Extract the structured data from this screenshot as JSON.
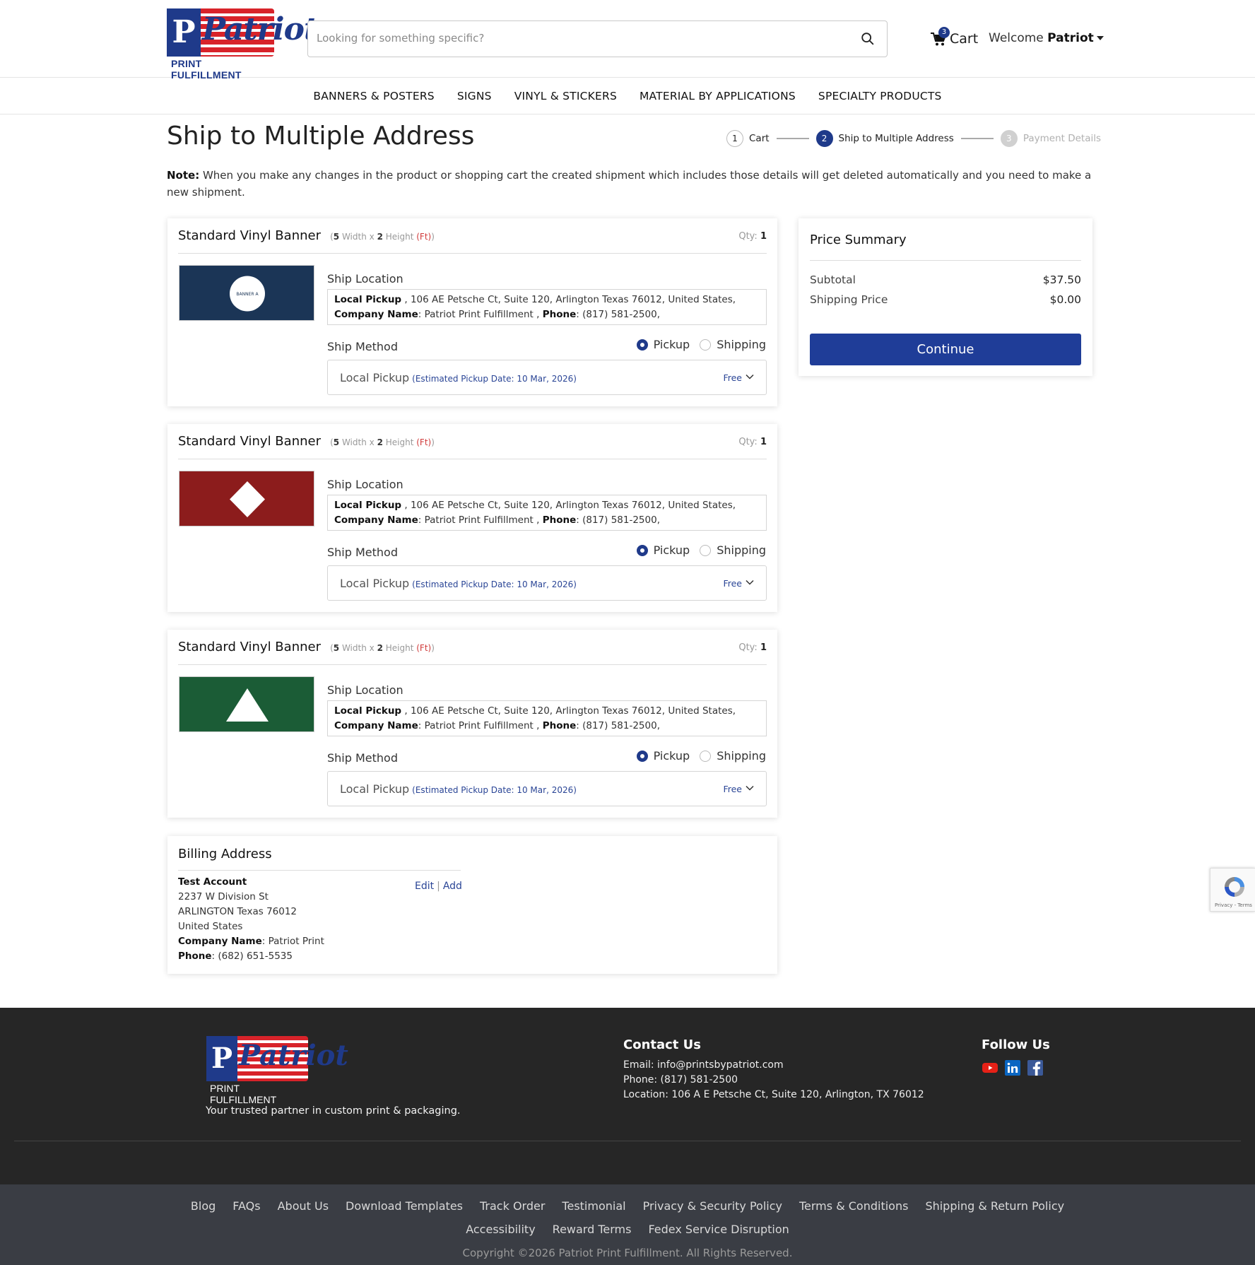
{
  "header": {
    "logo_word": "Patriot",
    "logo_sub": "PRINT FULFILLMENT",
    "search_placeholder": "Looking for something specific?",
    "cart_count": "3",
    "cart_label": "Cart",
    "welcome_prefix": "Welcome ",
    "welcome_user": "Patriot"
  },
  "nav": [
    "BANNERS & POSTERS",
    "SIGNS",
    "VINYL & STICKERS",
    "MATERIAL BY APPLICATIONS",
    "SPECIALTY PRODUCTS"
  ],
  "page": {
    "title": "Ship to Multiple Address",
    "note_label": "Note:",
    "note_text": " When you make any changes in the product or shopping cart the created shipment which includes those details will get deleted automatically and you need to make a new shipment."
  },
  "stepper": [
    {
      "num": "1",
      "label": "Cart",
      "state": "done"
    },
    {
      "num": "2",
      "label": "Ship to Multiple Address",
      "state": "active"
    },
    {
      "num": "3",
      "label": "Payment Details",
      "state": "inactive"
    }
  ],
  "items": [
    {
      "title": "Standard Vinyl Banner",
      "dims": {
        "w": "5",
        "w_label": "Width x",
        "h": "2",
        "h_label": "Height",
        "unit_open": "(",
        "unit": "(Ft)",
        "unit_close": ")"
      },
      "qty_label": "Qty:",
      "qty": "1",
      "thumb": {
        "color": "#1b3556",
        "shape": "circle",
        "text": "BANNER A"
      },
      "ship_location_label": "Ship Location",
      "loc": {
        "k1": "Local Pickup",
        "v1": " , 106 AE Petsche Ct, Suite 120, Arlington Texas 76012, United States, ",
        "k2": "Company Name",
        "v2": ": Patriot Print Fulfillment , ",
        "k3": "Phone",
        "v3": ": (817) 581-2500,"
      },
      "ship_method_label": "Ship Method",
      "radio_pickup": "Pickup",
      "radio_shipping": "Shipping",
      "method": "Local Pickup",
      "estimate": "(Estimated Pickup Date: 10 Mar, 2026)",
      "price": "Free"
    },
    {
      "title": "Standard Vinyl Banner",
      "dims": {
        "w": "5",
        "w_label": "Width x",
        "h": "2",
        "h_label": "Height",
        "unit_open": "(",
        "unit": "(Ft)",
        "unit_close": ")"
      },
      "qty_label": "Qty:",
      "qty": "1",
      "thumb": {
        "color": "#8c1c1c",
        "shape": "diamond",
        "text": ""
      },
      "ship_location_label": "Ship Location",
      "loc": {
        "k1": "Local Pickup",
        "v1": " , 106 AE Petsche Ct, Suite 120, Arlington Texas 76012, United States, ",
        "k2": "Company Name",
        "v2": ": Patriot Print Fulfillment , ",
        "k3": "Phone",
        "v3": ": (817) 581-2500,"
      },
      "ship_method_label": "Ship Method",
      "radio_pickup": "Pickup",
      "radio_shipping": "Shipping",
      "method": "Local Pickup",
      "estimate": "(Estimated Pickup Date: 10 Mar, 2026)",
      "price": "Free"
    },
    {
      "title": "Standard Vinyl Banner",
      "dims": {
        "w": "5",
        "w_label": "Width x",
        "h": "2",
        "h_label": "Height",
        "unit_open": "(",
        "unit": "(Ft)",
        "unit_close": ")"
      },
      "qty_label": "Qty:",
      "qty": "1",
      "thumb": {
        "color": "#1b5c36",
        "shape": "triangle",
        "text": ""
      },
      "ship_location_label": "Ship Location",
      "loc": {
        "k1": "Local Pickup",
        "v1": " , 106 AE Petsche Ct, Suite 120, Arlington Texas 76012, United States, ",
        "k2": "Company Name",
        "v2": ": Patriot Print Fulfillment , ",
        "k3": "Phone",
        "v3": ": (817) 581-2500,"
      },
      "ship_method_label": "Ship Method",
      "radio_pickup": "Pickup",
      "radio_shipping": "Shipping",
      "method": "Local Pickup",
      "estimate": "(Estimated Pickup Date: 10 Mar, 2026)",
      "price": "Free"
    }
  ],
  "summary": {
    "title": "Price Summary",
    "subtotal_label": "Subtotal",
    "subtotal": "$37.50",
    "shipping_label": "Shipping Price",
    "shipping": "$0.00",
    "continue": "Continue"
  },
  "billing": {
    "title": "Billing Address",
    "name": "Test Account",
    "street": "2237 W Division St",
    "city": "ARLINGTON Texas 76012",
    "country": "United States",
    "company_label": "Company Name",
    "company": ": Patriot Print",
    "phone_label": "Phone",
    "phone": ": (682) 651-5535",
    "edit": "Edit",
    "add": "Add"
  },
  "recaptcha": {
    "text": "Privacy - Terms"
  },
  "footer": {
    "tagline": "Your trusted partner in custom print & packaging.",
    "contact_title": "Contact Us",
    "email": "Email: info@printsbypatriot.com",
    "phone": "Phone: (817) 581-2500",
    "location": "Location: 106 A E Petsche Ct, Suite 120, Arlington, TX 76012",
    "follow_title": "Follow Us",
    "links": [
      "Blog",
      "FAQs",
      "About Us",
      "Download Templates",
      "Track Order",
      "Testimonial",
      "Privacy & Security Policy",
      "Terms & Conditions",
      "Shipping & Return Policy",
      "Accessibility",
      "Reward Terms",
      "Fedex Service Disruption"
    ],
    "copyright": "Copyright ©2026 Patriot Print Fulfillment. All Rights Reserved."
  },
  "colors": {
    "brand_blue": "#1f3d98",
    "brand_red": "#d8232a",
    "footer_bg": "#262626",
    "bottom_bg": "#3a3d44"
  }
}
